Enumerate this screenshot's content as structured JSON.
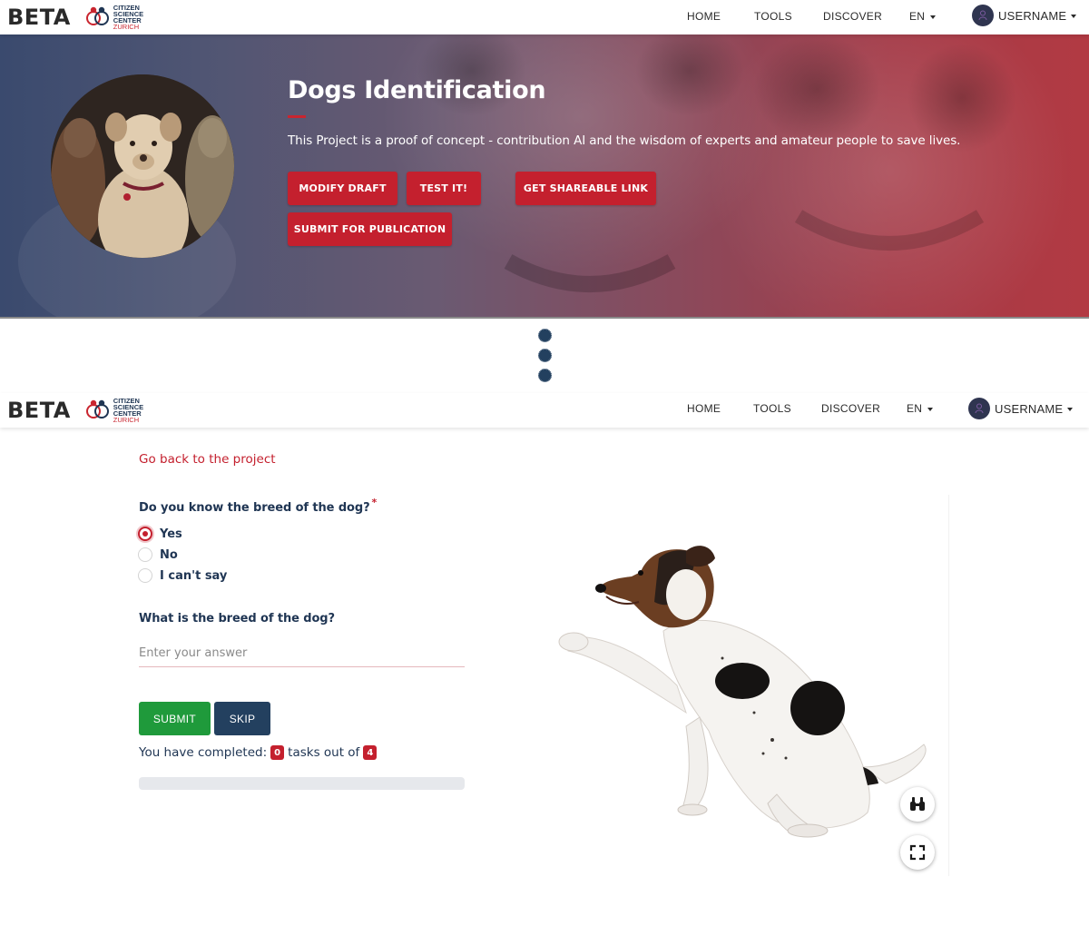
{
  "navbar": {
    "beta": "BETA",
    "logo_lines": [
      "CITIZEN",
      "SCIENCE",
      "CENTER",
      "ZURICH"
    ],
    "links": [
      "HOME",
      "TOOLS",
      "DISCOVER"
    ],
    "language": "EN",
    "username": "USERNAME"
  },
  "hero": {
    "title": "Dogs Identification",
    "description": "This Project is a proof of concept - contribution AI and the wisdom of experts and amateur people to save lives.",
    "buttons": {
      "modify_draft": "MODIFY DRAFT",
      "test_it": "TEST IT!",
      "get_shareable_link": "GET SHAREABLE LINK",
      "submit_for_publication": "SUBMIT FOR PUBLICATION"
    }
  },
  "task": {
    "back_link": "Go back to the project",
    "question1": {
      "label": "Do you know the breed of the dog?",
      "required_mark": "*",
      "options": [
        "Yes",
        "No",
        "I can't say"
      ],
      "selected": "Yes"
    },
    "question2": {
      "label": "What is the breed of the dog?",
      "placeholder": "Enter your answer",
      "value": ""
    },
    "submit_label": "SUBMIT",
    "skip_label": "SKIP",
    "progress": {
      "prefix": "You have completed:",
      "completed": "0",
      "middle": "tasks out of",
      "total": "4",
      "fraction": 0
    },
    "image_tools": [
      "binoculars-icon",
      "fullscreen-icon"
    ]
  },
  "colors": {
    "brand_red": "#c4202e",
    "navy": "#23405f",
    "submit_green": "#1f9a3b",
    "text_navy": "#1f3553"
  }
}
